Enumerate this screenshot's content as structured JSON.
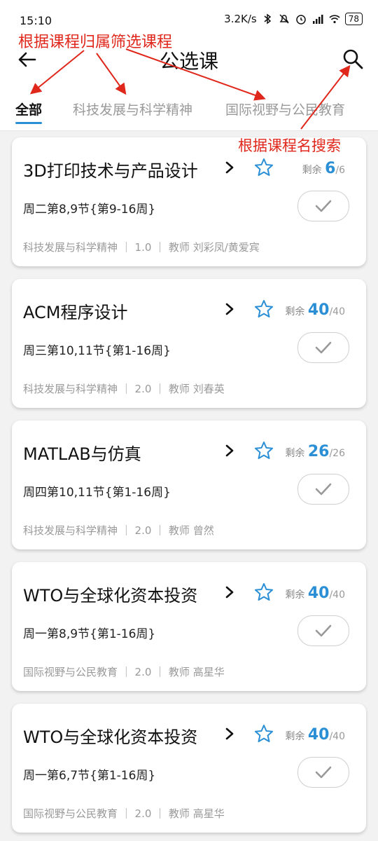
{
  "status": {
    "time": "15:10",
    "speed": "3.2K/s",
    "battery": "78"
  },
  "header": {
    "title": "公选课"
  },
  "tabs": [
    {
      "label": "全部",
      "active": true
    },
    {
      "label": "科技发展与科学精神",
      "active": false
    },
    {
      "label": "国际视野与公民教育",
      "active": false
    }
  ],
  "annotations": {
    "filter": "根据课程归属筛选课程",
    "search": "根据课程名搜索"
  },
  "courses": [
    {
      "name": "3D打印技术与产品设计",
      "remain_label": "剩余",
      "remain": "6",
      "total": "/6",
      "schedule": "周二第8,9节{第9-16周}",
      "meta": "科技发展与科学精神 ｜ 1.0 ｜ 教师 刘彩凤/黄爱宾"
    },
    {
      "name": "ACM程序设计",
      "remain_label": "剩余",
      "remain": "40",
      "total": "/40",
      "schedule": "周三第10,11节{第1-16周}",
      "meta": "科技发展与科学精神 ｜ 2.0 ｜ 教师 刘春英"
    },
    {
      "name": "MATLAB与仿真",
      "remain_label": "剩余",
      "remain": "26",
      "total": "/26",
      "schedule": "周四第10,11节{第1-16周}",
      "meta": "科技发展与科学精神 ｜ 2.0 ｜ 教师 曾然"
    },
    {
      "name": "WTO与全球化资本投资",
      "remain_label": "剩余",
      "remain": "40",
      "total": "/40",
      "schedule": "周一第8,9节{第1-16周}",
      "meta": "国际视野与公民教育 ｜ 2.0 ｜ 教师 高星华"
    },
    {
      "name": "WTO与全球化资本投资",
      "remain_label": "剩余",
      "remain": "40",
      "total": "/40",
      "schedule": "周一第6,7节{第1-16周}",
      "meta": "国际视野与公民教育 ｜ 2.0 ｜ 教师 高星华"
    }
  ],
  "colors": {
    "accent": "#2b8fd6",
    "annotation": "#e0271b"
  }
}
